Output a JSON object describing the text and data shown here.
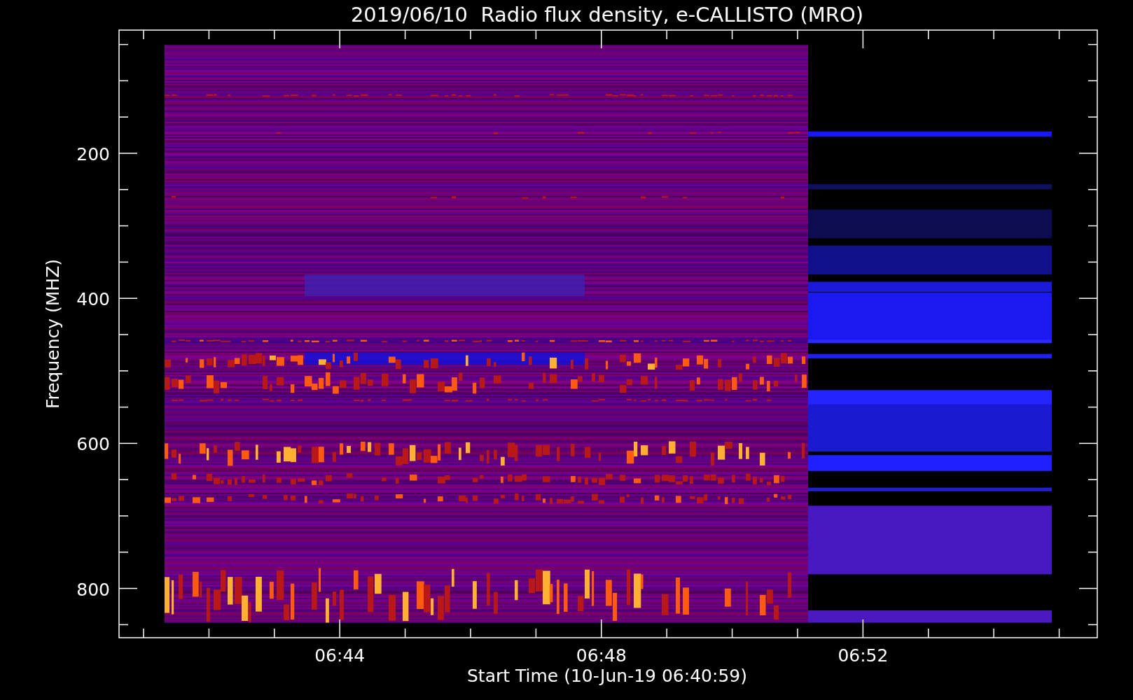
{
  "title": "2019/06/10  Radio flux density, e-CALLISTO (MRO)",
  "y_axis": {
    "label": "Frequency (MHZ)",
    "ticks": [
      "200",
      "400",
      "600",
      "800"
    ]
  },
  "x_axis": {
    "label": "Start Time (10-Jun-19 06:40:59)",
    "ticks": [
      "06:44",
      "06:48",
      "06:52"
    ]
  }
}
